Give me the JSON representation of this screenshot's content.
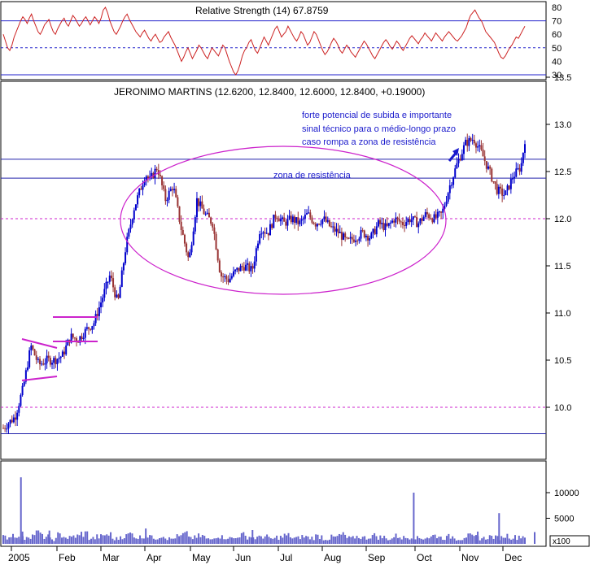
{
  "chart_data": [
    {
      "panel": "rsi",
      "type": "line",
      "title": "Relative Strength (14) 67.8759",
      "yticks": [
        30,
        40,
        50,
        60,
        70,
        80
      ],
      "ylim": [
        27,
        85
      ],
      "reference_lines": [
        30,
        50,
        70
      ],
      "series": [
        {
          "values": [
            60,
            55,
            50,
            48,
            52,
            58,
            62,
            66,
            70,
            73,
            71,
            68,
            72,
            75,
            70,
            66,
            62,
            60,
            63,
            67,
            69,
            71,
            66,
            62,
            60,
            64,
            67,
            70,
            72,
            68,
            66,
            70,
            74,
            72,
            69,
            66,
            68,
            71,
            73,
            70,
            67,
            70,
            73,
            71,
            68,
            72,
            78,
            80,
            76,
            70,
            66,
            62,
            60,
            63,
            66,
            70,
            73,
            75,
            71,
            68,
            65,
            62,
            60,
            58,
            61,
            63,
            60,
            57,
            55,
            58,
            60,
            57,
            54,
            55,
            58,
            60,
            62,
            58,
            55,
            52,
            48,
            44,
            40,
            43,
            47,
            50,
            46,
            42,
            45,
            48,
            52,
            50,
            47,
            44,
            42,
            46,
            50,
            48,
            46,
            44,
            48,
            52,
            50,
            45,
            40,
            36,
            32,
            30,
            33,
            38,
            44,
            48,
            50,
            54,
            56,
            52,
            48,
            46,
            50,
            54,
            58,
            55,
            52,
            56,
            60,
            64,
            66,
            62,
            58,
            60,
            62,
            66,
            63,
            60,
            57,
            55,
            58,
            62,
            60,
            56,
            52,
            54,
            58,
            62,
            60,
            56,
            52,
            48,
            45,
            47,
            50,
            54,
            57,
            55,
            52,
            48,
            46,
            49,
            52,
            50,
            47,
            45,
            43,
            46,
            49,
            52,
            55,
            53,
            50,
            47,
            44,
            42,
            45,
            48,
            51,
            54,
            56,
            54,
            51,
            49,
            52,
            55,
            53,
            50,
            48,
            51,
            54,
            57,
            59,
            57,
            55,
            53,
            56,
            58,
            61,
            59,
            57,
            55,
            58,
            61,
            59,
            57,
            55,
            58,
            60,
            62,
            60,
            58,
            56,
            55,
            57,
            59,
            62,
            65,
            70,
            74,
            76,
            78,
            75,
            72,
            70,
            66,
            62,
            60,
            58,
            56,
            54,
            50,
            46,
            43,
            42,
            44,
            47,
            50,
            52,
            55,
            58,
            57,
            60,
            63,
            66
          ]
        }
      ]
    },
    {
      "panel": "price",
      "type": "candlestick",
      "title": "JERONIMO MARTINS (12.6200, 12.8400, 12.6000, 12.8400, +0.19000)",
      "yticks": [
        10.0,
        10.5,
        11.0,
        11.5,
        12.0,
        12.5,
        13.0,
        13.5
      ],
      "ylim": [
        9.5,
        13.65
      ],
      "xticks": [
        "2005",
        "Feb",
        "Mar",
        "Apr",
        "May",
        "Jun",
        "Jul",
        "Aug",
        "Sep",
        "Oct",
        "Nov",
        "Dec"
      ],
      "annotations": [
        "forte potencial de subida e importante",
        "sinal técnico para o médio-longo prazo",
        "caso rompa a zona de resistência",
        "zona de resistência"
      ],
      "hlines_solid": [
        12.63,
        12.43,
        9.72
      ],
      "hlines_dashed": [
        12.0,
        10.0
      ],
      "close_path": [
        [
          0,
          9.78
        ],
        [
          1.5,
          9.9
        ],
        [
          2.5,
          10.2
        ],
        [
          3.5,
          10.65
        ],
        [
          4.5,
          10.45
        ],
        [
          5.5,
          10.5
        ],
        [
          6.5,
          10.5
        ],
        [
          7.5,
          10.55
        ],
        [
          8.5,
          10.75
        ],
        [
          9.5,
          10.72
        ],
        [
          10.5,
          10.82
        ],
        [
          11.5,
          10.9
        ],
        [
          12.5,
          11.15
        ],
        [
          13.5,
          11.4
        ],
        [
          14.5,
          11.1
        ],
        [
          15.5,
          11.7
        ],
        [
          16.5,
          12.1
        ],
        [
          17.5,
          12.35
        ],
        [
          18.0,
          12.48
        ],
        [
          18.5,
          12.4
        ],
        [
          19.5,
          12.55
        ],
        [
          20.5,
          12.2
        ],
        [
          21.5,
          12.35
        ],
        [
          22.5,
          11.9
        ],
        [
          23.5,
          11.55
        ],
        [
          24.5,
          12.2
        ],
        [
          25.5,
          12.05
        ],
        [
          26.5,
          11.95
        ],
        [
          27.5,
          11.4
        ],
        [
          28.5,
          11.35
        ],
        [
          29.5,
          11.45
        ],
        [
          30.5,
          11.5
        ],
        [
          31.5,
          11.45
        ],
        [
          32.5,
          11.9
        ],
        [
          33.5,
          11.85
        ],
        [
          34.5,
          12.05
        ],
        [
          35.5,
          11.95
        ],
        [
          36.5,
          12.0
        ],
        [
          37.5,
          11.95
        ],
        [
          38.5,
          12.05
        ],
        [
          39.5,
          11.95
        ],
        [
          40.5,
          12.0
        ],
        [
          41.5,
          11.9
        ],
        [
          42.5,
          11.85
        ],
        [
          43.5,
          11.75
        ],
        [
          44.5,
          11.8
        ],
        [
          45.5,
          11.85
        ],
        [
          46.5,
          11.8
        ],
        [
          47.5,
          11.95
        ],
        [
          48.5,
          11.9
        ],
        [
          49.5,
          12.0
        ],
        [
          50.5,
          11.95
        ],
        [
          51.5,
          12.0
        ],
        [
          52.5,
          11.95
        ],
        [
          53.5,
          12.05
        ],
        [
          54.5,
          12.0
        ],
        [
          55.5,
          12.05
        ],
        [
          56.5,
          12.35
        ],
        [
          57.5,
          12.6
        ],
        [
          58.5,
          12.8
        ],
        [
          59.5,
          12.85
        ],
        [
          60.5,
          12.7
        ],
        [
          61.5,
          12.5
        ],
        [
          62.5,
          12.3
        ],
        [
          63.5,
          12.25
        ],
        [
          64.5,
          12.45
        ],
        [
          65.5,
          12.55
        ],
        [
          66.0,
          12.84
        ]
      ]
    },
    {
      "panel": "volume",
      "type": "bar",
      "ylabel": "x100",
      "yticks": [
        5000,
        10000
      ],
      "ylim": [
        0,
        13500
      ],
      "spikes": [
        {
          "x": 1.0,
          "value": 13000
        },
        {
          "x": 1.2,
          "value": 2400
        },
        {
          "x": 4.6,
          "value": 2600
        },
        {
          "x": 16.8,
          "value": 3000
        },
        {
          "x": 30.3,
          "value": 2700
        },
        {
          "x": 50.7,
          "value": 10000
        },
        {
          "x": 58.8,
          "value": 2400
        },
        {
          "x": 61.5,
          "value": 6000
        },
        {
          "x": 66.0,
          "value": 2300
        }
      ],
      "baseline_values": [
        1300,
        1800,
        1100,
        1600,
        2100,
        1400,
        900,
        1700,
        1200,
        1500,
        2000,
        1100,
        1400,
        1800,
        1000,
        1500,
        1900,
        1300,
        1700,
        1200,
        1600,
        1000,
        1400,
        1800,
        1200,
        1500,
        900,
        1600,
        1300,
        1100,
        1700,
        1400,
        1200,
        1500,
        1000,
        1300,
        1600,
        1100,
        1400,
        1200,
        1500,
        1000,
        1300,
        1700,
        1100,
        1400,
        1200,
        1600,
        1300,
        1000,
        1500,
        1200,
        1400,
        1100,
        1300,
        1600,
        1200,
        1400,
        1000,
        1500,
        1300,
        1100,
        1400,
        1200,
        1600,
        1300,
        1500
      ]
    }
  ],
  "ui": {
    "rsi_yticks": [
      "80",
      "70",
      "60",
      "50",
      "40",
      "30"
    ],
    "price_yticks": [
      "13.5",
      "13.0",
      "12.5",
      "12.0",
      "11.5",
      "11.0",
      "10.5",
      "10.0"
    ],
    "vol_yticks": [
      "10000",
      "5000"
    ]
  }
}
